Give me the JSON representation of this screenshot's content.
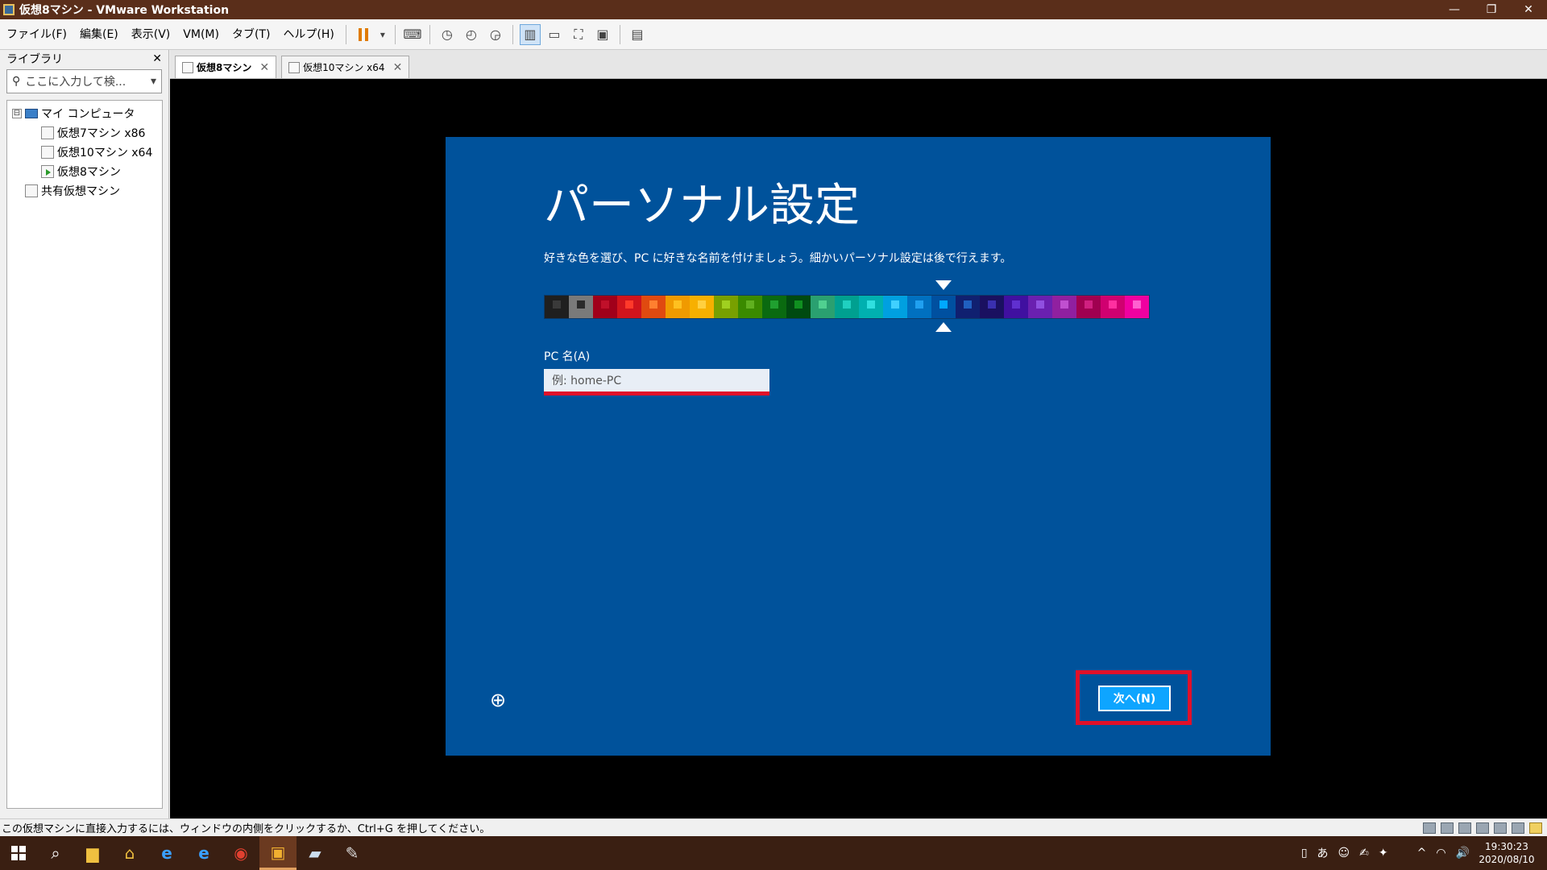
{
  "window": {
    "title": "仮想8マシン - VMware Workstation",
    "min": "—",
    "max": "❐",
    "close": "✕"
  },
  "menu": {
    "items": [
      "ファイル(F)",
      "編集(E)",
      "表示(V)",
      "VM(M)",
      "タブ(T)",
      "ヘルプ(H)"
    ]
  },
  "toolbar": {
    "dropdown": "▾"
  },
  "library": {
    "title": "ライブラリ",
    "close": "✕",
    "search_placeholder": "ここに入力して検...",
    "search_dropdown": "▾",
    "tree": {
      "root_expand": "⊟",
      "root_label": "マイ コンピュータ",
      "vms": [
        "仮想7マシン x86",
        "仮想10マシン x64",
        "仮想8マシン"
      ],
      "shared_label": "共有仮想マシン"
    }
  },
  "tabs": [
    {
      "label": "仮想8マシン",
      "active": true
    },
    {
      "label": "仮想10マシン x64",
      "active": false
    }
  ],
  "tab_close": "✕",
  "oobe": {
    "heading": "パーソナル設定",
    "description": "好きな色を選び、PC に好きな名前を付けましょう。細かいパーソナル設定は後で行えます。",
    "pc_name_label": "PC 名(A)",
    "pc_name_placeholder": "例: home-PC",
    "next_button": "次へ(N)",
    "access_icon": "⊕",
    "selected_color_index": 16,
    "palette": [
      {
        "bg": "#1f1f1f",
        "fg": "#3a3a3a"
      },
      {
        "bg": "#7a7a7a",
        "fg": "#2a2a2a"
      },
      {
        "bg": "#a0001a",
        "fg": "#c0102a"
      },
      {
        "bg": "#d0141c",
        "fg": "#ff3a2a"
      },
      {
        "bg": "#e04a10",
        "fg": "#ff8030"
      },
      {
        "bg": "#f09a00",
        "fg": "#ffc020"
      },
      {
        "bg": "#f7b000",
        "fg": "#ffd040"
      },
      {
        "bg": "#78a000",
        "fg": "#a0d020"
      },
      {
        "bg": "#3a8a00",
        "fg": "#60b020"
      },
      {
        "bg": "#0a6a10",
        "fg": "#20a030"
      },
      {
        "bg": "#004a10",
        "fg": "#109020"
      },
      {
        "bg": "#2aa070",
        "fg": "#50d090"
      },
      {
        "bg": "#00a090",
        "fg": "#20d0c0"
      },
      {
        "bg": "#00b0b0",
        "fg": "#30e0e0"
      },
      {
        "bg": "#00a0e0",
        "fg": "#40d0ff"
      },
      {
        "bg": "#0070c0",
        "fg": "#20a0f0"
      },
      {
        "bg": "#0050a0",
        "fg": "#00a8ff"
      },
      {
        "bg": "#102070",
        "fg": "#2060c0"
      },
      {
        "bg": "#1a1060",
        "fg": "#3a30b0"
      },
      {
        "bg": "#4010a0",
        "fg": "#6030d0"
      },
      {
        "bg": "#6a20b0",
        "fg": "#9050e0"
      },
      {
        "bg": "#9020a0",
        "fg": "#c050d0"
      },
      {
        "bg": "#a00050",
        "fg": "#d02080"
      },
      {
        "bg": "#d00070",
        "fg": "#ff30a0"
      },
      {
        "bg": "#f000a0",
        "fg": "#ff60d0"
      }
    ]
  },
  "status": {
    "text": "この仮想マシンに直接入力するには、ウィンドウの内側をクリックするか、Ctrl+G を押してください。"
  },
  "taskbar": {
    "search_icon": "⌕",
    "ime_mode": "あ",
    "tray_chevron": "^",
    "volume": "🔊",
    "time": "19:30:23",
    "date": "2020/08/10"
  }
}
